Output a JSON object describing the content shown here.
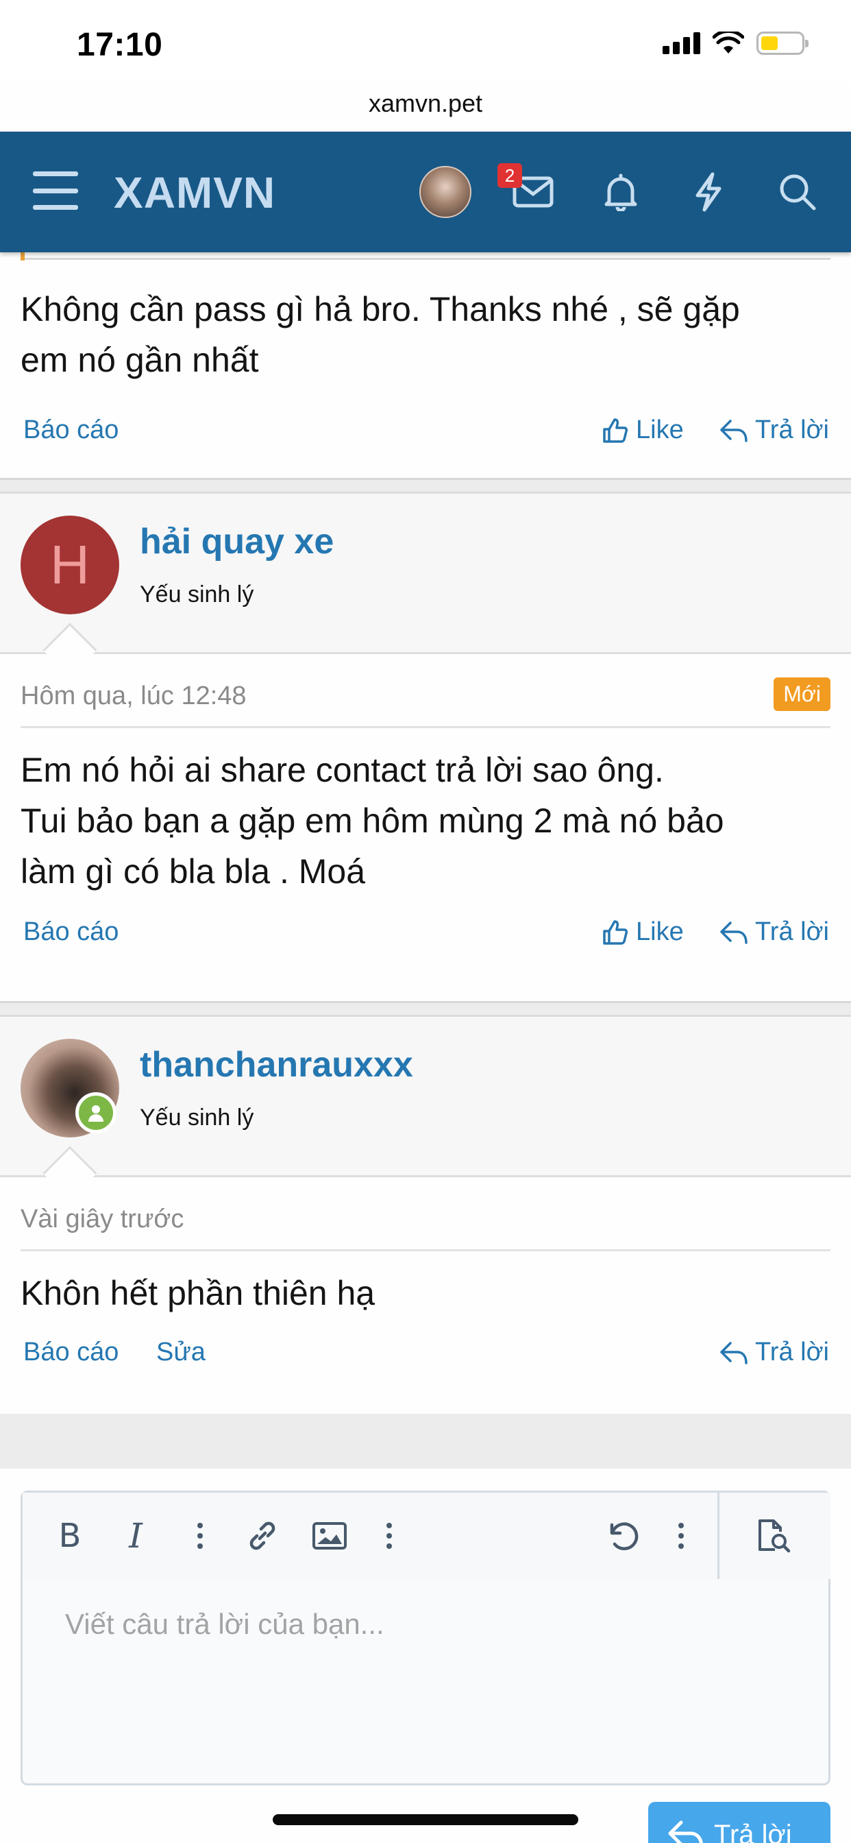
{
  "status_bar": {
    "time": "17:10"
  },
  "browser": {
    "url": "xamvn.pet"
  },
  "nav": {
    "logo": "XAMVN",
    "messages_badge": "2"
  },
  "posts": [
    {
      "text_lines": [
        "Không cần pass gì hả bro. Thanks nhé , sẽ gặp",
        "em nó gần nhất"
      ],
      "actions": {
        "report": "Báo cáo",
        "like": "Like",
        "reply": "Trả lời"
      }
    },
    {
      "avatar_letter": "H",
      "username": "hải quay xe",
      "user_title": "Yếu sinh lý",
      "date": "Hôm qua, lúc 12:48",
      "new_badge": "Mới",
      "text_lines": [
        "Em nó hỏi ai share contact trả lời sao ông.",
        "Tui bảo bạn a gặp em hôm mùng 2 mà nó bảo",
        "làm gì có bla bla . Moá"
      ],
      "actions": {
        "report": "Báo cáo",
        "like": "Like",
        "reply": "Trả lời"
      }
    },
    {
      "username": "thanchanrauxxx",
      "user_title": "Yếu sinh lý",
      "date": "Vài giây trước",
      "text_lines": [
        "Khôn hết phần thiên hạ"
      ],
      "actions": {
        "report": "Báo cáo",
        "edit": "Sửa",
        "reply": "Trả lời"
      }
    }
  ],
  "editor": {
    "placeholder": "Viết câu trả lời của bạn...",
    "submit_label": "Trả lời"
  },
  "colors": {
    "nav_bg": "#185886",
    "link": "#2577b1",
    "new_badge": "#f29b21",
    "online": "#7db846"
  }
}
